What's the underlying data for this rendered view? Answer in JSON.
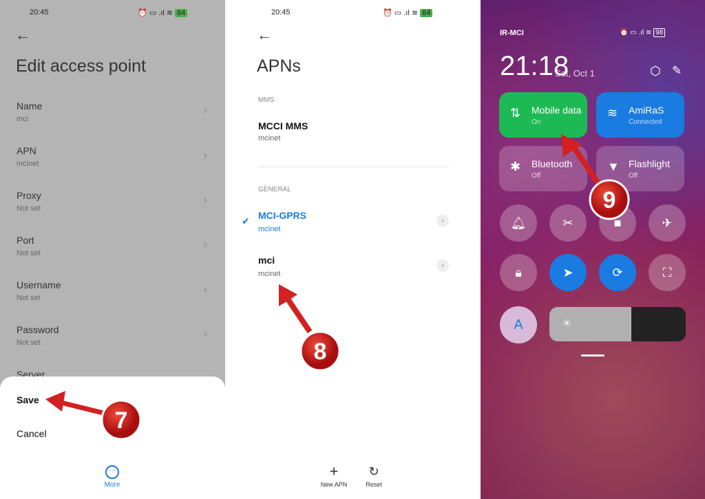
{
  "panel1": {
    "status": {
      "time": "20:45",
      "battery": "64"
    },
    "title": "Edit access point",
    "items": [
      {
        "label": "Name",
        "value": "mci"
      },
      {
        "label": "APN",
        "value": "mcinet"
      },
      {
        "label": "Proxy",
        "value": "Not set"
      },
      {
        "label": "Port",
        "value": "Not set"
      },
      {
        "label": "Username",
        "value": "Not set"
      },
      {
        "label": "Password",
        "value": "Not set"
      },
      {
        "label": "Server",
        "value": ""
      }
    ],
    "sheet": {
      "save": "Save",
      "cancel": "Cancel",
      "more": "More"
    },
    "badge": "7"
  },
  "panel2": {
    "status": {
      "time": "20:45",
      "battery": "64"
    },
    "title": "APNs",
    "sections": [
      {
        "header": "MMS",
        "items": [
          {
            "name": "MCCI MMS",
            "apn": "mcinet"
          }
        ]
      },
      {
        "header": "GENERAL",
        "items": [
          {
            "name": "MCI-GPRS",
            "apn": "mcinet",
            "selected": true
          },
          {
            "name": "mci",
            "apn": "mcinet"
          }
        ]
      }
    ],
    "toolbar": {
      "new_apn": "New APN",
      "reset": "Reset"
    },
    "badge": "8"
  },
  "panel3": {
    "carrier": "IR-MCI",
    "battery": "98",
    "time": "21:18",
    "date": "Sat, Oct 1",
    "tiles": [
      {
        "title": "Mobile data",
        "sub": "On",
        "color": "#1db954"
      },
      {
        "title": "AmiRaS",
        "sub": "Connected",
        "color": "#1a7be0"
      },
      {
        "title": "Bluetooth",
        "sub": "Off"
      },
      {
        "title": "Flashlight",
        "sub": "Off"
      }
    ],
    "auto_brightness": "A",
    "brightness_percent": 60,
    "badge": "9"
  },
  "colors": {
    "accent": "#1a7be0",
    "annotation": "#d42020"
  }
}
